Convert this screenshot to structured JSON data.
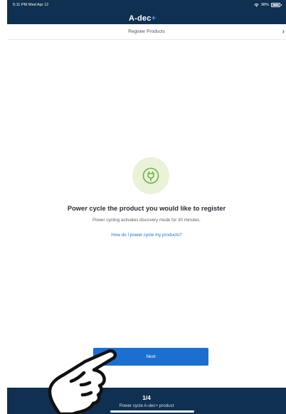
{
  "status_bar": {
    "time": "5:11 PM  Wed Apr 12",
    "battery": "98%",
    "battery_level": 0.98
  },
  "app": {
    "logo_text": "A-dec",
    "logo_plus": "+"
  },
  "nav": {
    "title": "Register Products"
  },
  "main": {
    "headline": "Power cycle the product you would like to register",
    "subline": "Power cycling activates discovery mode for 30 minutes.",
    "help_link": "How do I power cycle my products?",
    "next_label": "Next"
  },
  "footer": {
    "step": "1/4",
    "step_desc": "Power cycle A-dec+ product"
  },
  "colors": {
    "header_bg": "#0f3050",
    "accent": "#1a6fd0",
    "icon_circle": "#eaf3d9",
    "icon_green": "#6bb344"
  }
}
